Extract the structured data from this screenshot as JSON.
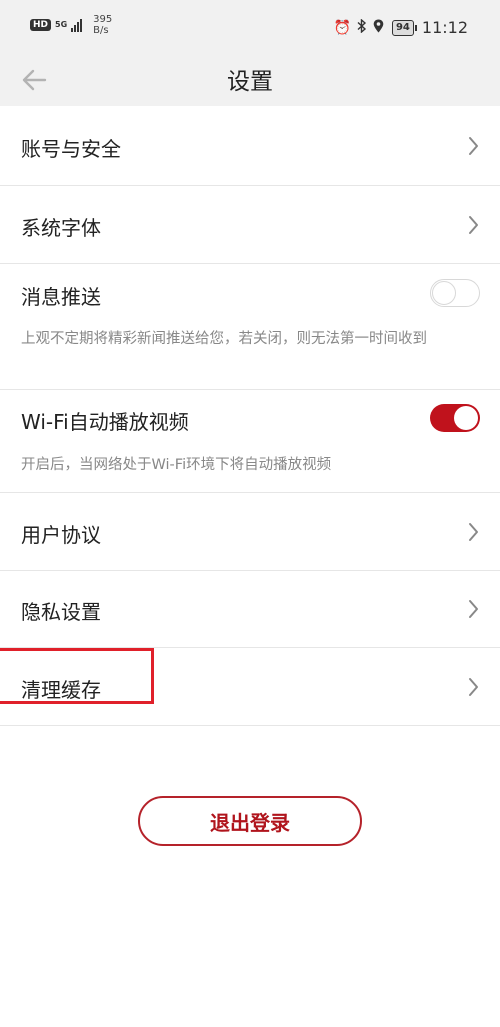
{
  "status_bar": {
    "hd": "HD",
    "net_type": "5G",
    "speed_value": "395",
    "speed_unit": "B/s",
    "battery": "94",
    "time": "11:12"
  },
  "header": {
    "title": "设置"
  },
  "settings": {
    "account_security": "账号与安全",
    "system_font": "系统字体",
    "push": {
      "label": "消息推送",
      "enabled": false,
      "description": "上观不定期将精彩新闻推送给您，若关闭，则无法第一时间收到"
    },
    "wifi_autoplay": {
      "label": "Wi-Fi自动播放视频",
      "enabled": true,
      "description": "开启后，当网络处于Wi-Fi环境下将自动播放视频"
    },
    "user_agreement": "用户协议",
    "privacy": "隐私设置",
    "clear_cache": "清理缓存"
  },
  "logout_label": "退出登录",
  "colors": {
    "accent": "#c0121c",
    "highlight": "#e0202a"
  }
}
